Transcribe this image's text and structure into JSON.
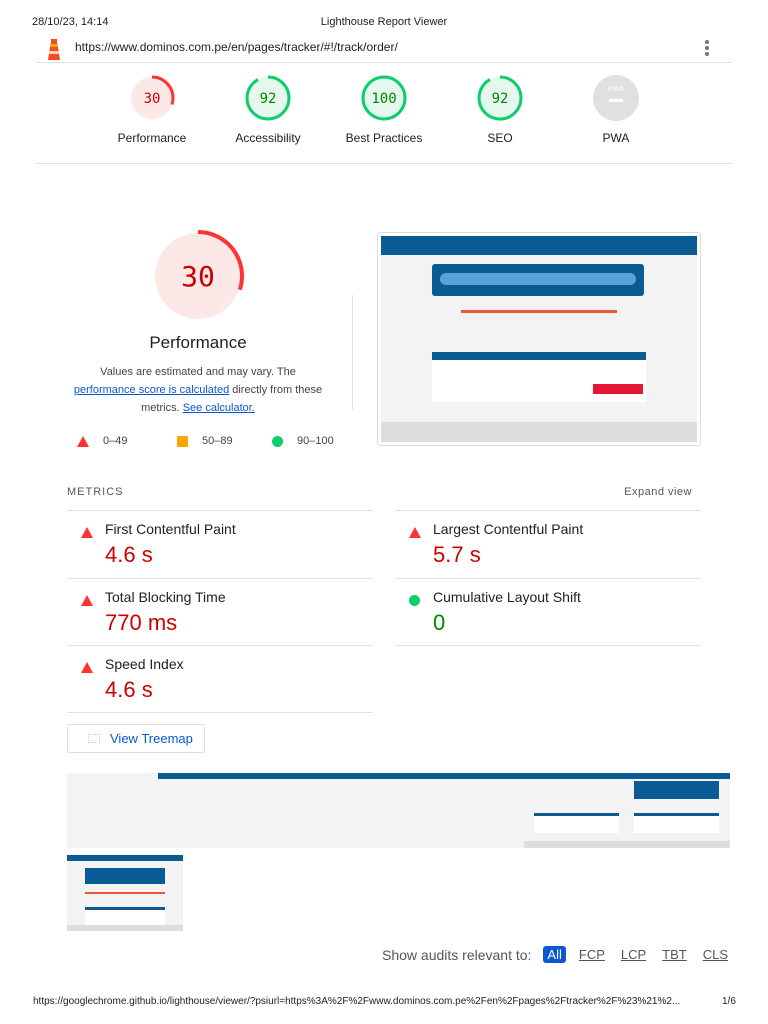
{
  "print_header": {
    "datetime": "28/10/23, 14:14",
    "title": "Lighthouse Report Viewer"
  },
  "topbar": {
    "url": "https://www.dominos.com.pe/en/pages/tracker/#!/track/order/"
  },
  "gauges": [
    {
      "score": 30,
      "label": "Performance",
      "status": "fail"
    },
    {
      "score": 92,
      "label": "Accessibility",
      "status": "pass"
    },
    {
      "score": 100,
      "label": "Best Practices",
      "status": "pass"
    },
    {
      "score": 92,
      "label": "SEO",
      "status": "pass"
    },
    {
      "score": "PWA",
      "label": "PWA",
      "status": "na"
    }
  ],
  "perf": {
    "score": 30,
    "title": "Performance",
    "desc1": "Values are estimated and may vary. The",
    "link1": "performance score is calculated",
    "desc2": " directly from these",
    "desc3": "metrics. ",
    "link2": "See calculator.",
    "legend": [
      {
        "range": "0–49",
        "shape": "triangle"
      },
      {
        "range": "50–89",
        "shape": "square"
      },
      {
        "range": "90–100",
        "shape": "circle"
      }
    ]
  },
  "metrics": {
    "heading": "METRICS",
    "expand": "Expand view",
    "items": [
      {
        "label": "First Contentful Paint",
        "value": "4.6 s",
        "status": "fail"
      },
      {
        "label": "Largest Contentful Paint",
        "value": "5.7 s",
        "status": "fail"
      },
      {
        "label": "Total Blocking Time",
        "value": "770 ms",
        "status": "fail"
      },
      {
        "label": "Cumulative Layout Shift",
        "value": "0",
        "status": "pass"
      },
      {
        "label": "Speed Index",
        "value": "4.6 s",
        "status": "fail"
      }
    ]
  },
  "treemap_button": "View Treemap",
  "audit_filter": {
    "label": "Show audits relevant to:",
    "options": [
      "All",
      "FCP",
      "LCP",
      "TBT",
      "CLS"
    ],
    "selected": "All"
  },
  "print_footer": {
    "url": "https://googlechrome.github.io/lighthouse/viewer/?psiurl=https%3A%2F%2Fwww.dominos.com.pe%2Fen%2Fpages%2Ftracker%2F%23%21%2...",
    "page": "1/6"
  },
  "colors": {
    "fail": "#ff3333",
    "fail_text": "#c00",
    "average": "#ffa400",
    "pass": "#0cce6b",
    "pass_text": "#080",
    "link": "#0b57d0"
  }
}
